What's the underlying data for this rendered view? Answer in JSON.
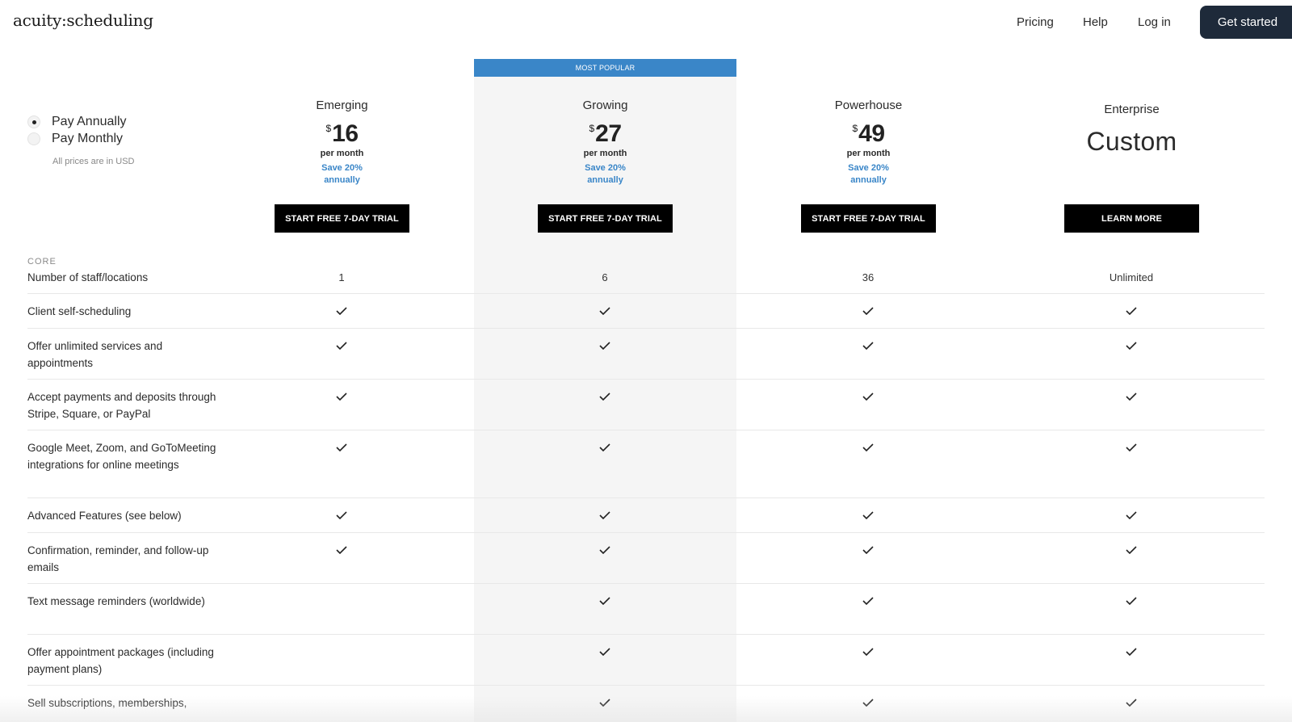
{
  "header": {
    "logo": "acuity:scheduling",
    "nav": {
      "pricing": "Pricing",
      "help": "Help",
      "login": "Log in"
    },
    "cta": "Get started"
  },
  "billing": {
    "options": [
      {
        "label": "Pay Annually",
        "selected": true
      },
      {
        "label": "Pay Monthly",
        "selected": false
      }
    ],
    "note": "All prices are in USD"
  },
  "popular_badge": "MOST POPULAR",
  "plans": [
    {
      "name": "Emerging",
      "currency": "$",
      "price": "16",
      "period": "per month",
      "save_line1": "Save 20%",
      "save_line2": "annually",
      "button": "START FREE 7-DAY TRIAL"
    },
    {
      "name": "Growing",
      "currency": "$",
      "price": "27",
      "period": "per month",
      "save_line1": "Save 20%",
      "save_line2": "annually",
      "button": "START FREE 7-DAY TRIAL",
      "popular": true
    },
    {
      "name": "Powerhouse",
      "currency": "$",
      "price": "49",
      "period": "per month",
      "save_line1": "Save 20%",
      "save_line2": "annually",
      "button": "START FREE 7-DAY TRIAL"
    },
    {
      "name": "Enterprise",
      "custom_price": "Custom",
      "button": "LEARN MORE"
    }
  ],
  "section": "CORE",
  "rows": [
    {
      "feature": "Number of staff/locations",
      "values": [
        "1",
        "6",
        "36",
        "Unlimited"
      ]
    },
    {
      "feature": "Client self-scheduling",
      "checks": [
        true,
        true,
        true,
        true
      ]
    },
    {
      "feature": "Offer unlimited services and appointments",
      "checks": [
        true,
        true,
        true,
        true
      ]
    },
    {
      "feature": "Accept payments and deposits through Stripe, Square, or PayPal",
      "checks": [
        true,
        true,
        true,
        true
      ]
    },
    {
      "feature": "Google Meet, Zoom, and GoToMeeting integrations for online meetings",
      "checks": [
        true,
        true,
        true,
        true
      ]
    },
    {
      "feature": "Advanced Features (see below)",
      "checks": [
        true,
        true,
        true,
        true
      ]
    },
    {
      "feature": "Confirmation, reminder, and follow-up emails",
      "checks": [
        true,
        true,
        true,
        true
      ]
    },
    {
      "feature": "Text message reminders (worldwide)",
      "checks": [
        false,
        true,
        true,
        true
      ]
    },
    {
      "feature": "Offer appointment packages (including payment plans)",
      "checks": [
        false,
        true,
        true,
        true
      ]
    },
    {
      "feature": "Sell subscriptions, memberships,",
      "checks": [
        false,
        true,
        true,
        true
      ]
    }
  ],
  "icons": {
    "check": "check-icon"
  },
  "colors": {
    "accent": "#3a86c8",
    "cta_bg": "#1e2a3a",
    "popular_bg": "#f5f5f5",
    "button_bg": "#000000"
  }
}
